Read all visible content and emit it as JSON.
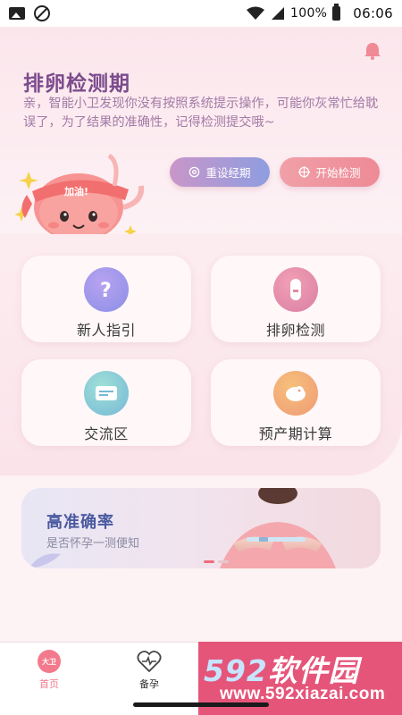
{
  "status_bar": {
    "battery_text": "100%",
    "time": "06:06",
    "left_icons": [
      "image-icon",
      "blocked-icon"
    ],
    "right_icons": [
      "wifi-icon",
      "signal-icon",
      "battery-icon"
    ]
  },
  "header": {
    "title": "排卵检测期",
    "notice": "亲，智能小卫发现你没有按照系统提示操作，可能你灰常忙给耽误了，为了结果的准确性，记得检测提交哦~",
    "mascot_badge": "加油!",
    "reset_button": "重设经期",
    "start_button": "开始检测",
    "bell_icon": "bell-icon"
  },
  "grid": [
    {
      "label": "新人指引",
      "icon": "question-icon",
      "color": "#9b8ce8"
    },
    {
      "label": "排卵检测",
      "icon": "test-strip-icon",
      "color": "#e58aa0"
    },
    {
      "label": "交流区",
      "icon": "chat-icon",
      "color": "#7cc5cf"
    },
    {
      "label": "预产期计算",
      "icon": "baby-icon",
      "color": "#f2a87a"
    }
  ],
  "banner": {
    "title": "高准确率",
    "subtitle": "是否怀孕一测便知"
  },
  "bottom_nav": {
    "home_badge": "大卫",
    "items": [
      {
        "label": "首页",
        "icon": "home-icon",
        "active": true
      },
      {
        "label": "备孕",
        "icon": "heart-pulse-icon",
        "active": false
      }
    ]
  },
  "watermark": {
    "brand_num": "592",
    "brand_text": "软件园",
    "url": "www.592xiazai.com"
  },
  "colors": {
    "accent": "#f27a8c",
    "title": "#7c4c8d",
    "notice": "#a37aa6"
  }
}
